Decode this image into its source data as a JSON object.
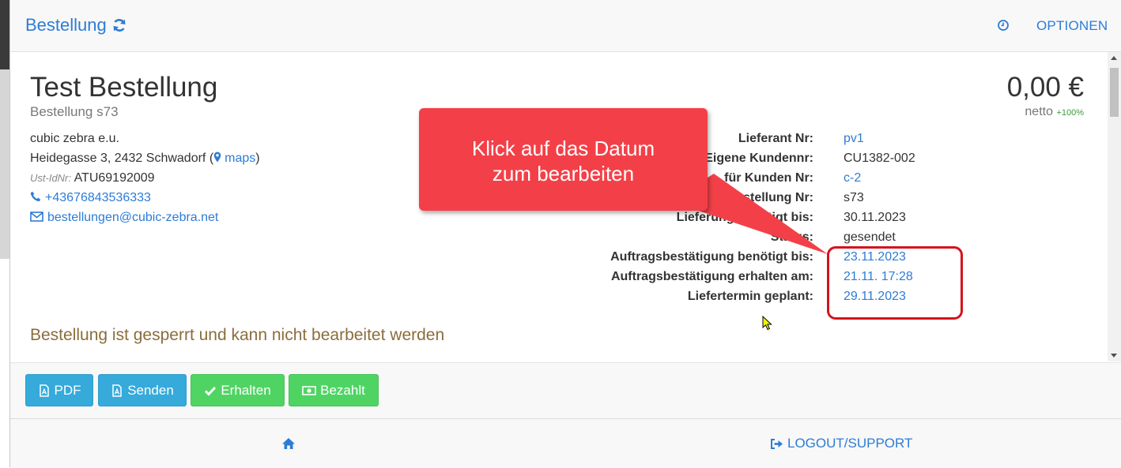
{
  "header": {
    "brand": "Bestellung",
    "options_label": "OPTIONEN"
  },
  "order": {
    "title": "Test Bestellung",
    "subtitle": "Bestellung s73",
    "total": "0,00 €",
    "netto_label": "netto",
    "netto_pct": "+100%"
  },
  "supplier": {
    "name": "cubic zebra e.u.",
    "address": "Heidegasse 3, 2432 Schwadorf (",
    "maps_label": "maps",
    "address_close": ")",
    "ust_label": "Ust-IdNr:",
    "ust_value": "ATU69192009",
    "phone": "+43676843536333",
    "email": "bestellungen@cubic-zebra.net"
  },
  "details": [
    {
      "label": "Lieferant Nr:",
      "value": "pv1"
    },
    {
      "label": "Eigene Kundennr:",
      "value": "CU1382-002"
    },
    {
      "label": "für Kunden Nr:",
      "value": "c-2"
    },
    {
      "label": "Bestellung Nr:",
      "value": "s73"
    },
    {
      "label": "Lieferung benötigt bis:",
      "value": "30.11.2023"
    },
    {
      "label": "Status:",
      "value": "gesendet"
    },
    {
      "label": "Auftragsbestätigung benötigt bis:",
      "value": "23.11.2023"
    },
    {
      "label": "Auftragsbestätigung erhalten am:",
      "value": "21.11. 17:28"
    },
    {
      "label": "Liefertermin geplant:",
      "value": "29.11.2023"
    }
  ],
  "locked_message": "Bestellung ist gesperrt und kann nicht bearbeitet werden",
  "buttons": {
    "pdf": "PDF",
    "senden": "Senden",
    "erhalten": "Erhalten",
    "bezahlt": "Bezahlt"
  },
  "footer": {
    "logout": "LOGOUT/SUPPORT"
  },
  "annotation": {
    "callout_line1": "Klick auf das Datum",
    "callout_line2": "zum bearbeiten"
  },
  "colors": {
    "link": "#2d7cd6",
    "info_button": "#35aadb",
    "success_button": "#4fd463",
    "callout": "#f34048",
    "highlight": "#d4141c",
    "warning_text": "#8a6d3b"
  },
  "icons": [
    "refresh-icon",
    "clock-icon",
    "map-marker-icon",
    "phone-icon",
    "envelope-icon",
    "pdf-file-icon",
    "check-icon",
    "money-icon",
    "home-icon",
    "logout-icon",
    "mouse-cursor-icon"
  ]
}
